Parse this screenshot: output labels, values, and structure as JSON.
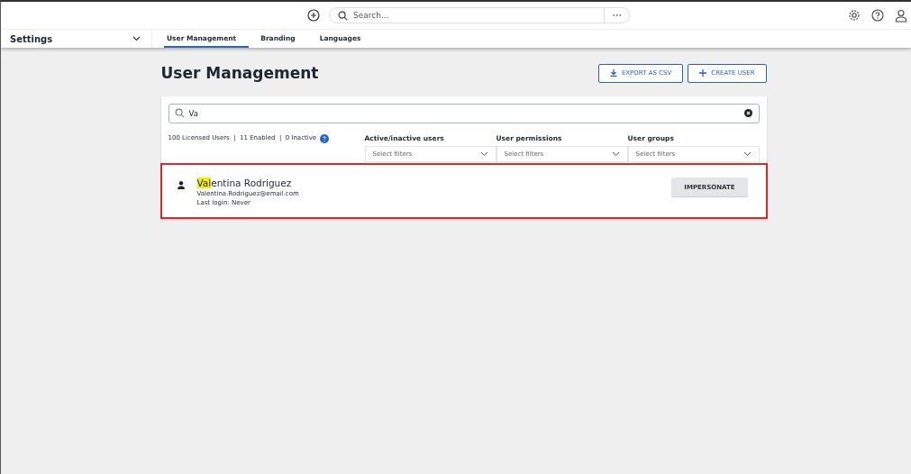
{
  "topbar": {
    "search_placeholder": "Search...",
    "more": "•••"
  },
  "nav": {
    "section": "Settings",
    "tabs": [
      {
        "label": "User Management",
        "selected": true
      },
      {
        "label": "Branding",
        "selected": false
      },
      {
        "label": "Languages",
        "selected": false
      }
    ]
  },
  "page": {
    "title": "User Management",
    "buttons": [
      {
        "kind": "export",
        "label": "EXPORT AS CSV"
      },
      {
        "kind": "create",
        "label": "CREATE USER"
      }
    ]
  },
  "search": {
    "value": "Va"
  },
  "summary": "100 Licensed Users  |  11 Enabled  |  0 Inactive",
  "filters": [
    {
      "label": "Active/inactive users",
      "placeholder": "Select filters"
    },
    {
      "label": "User permissions",
      "placeholder": "Select filters"
    },
    {
      "label": "User groups",
      "placeholder": "Select filters"
    }
  ],
  "results": [
    {
      "name_match": "Val",
      "name_rest": "entina Rodriguez",
      "email": "Valentina.Rodriguez@email.com",
      "last_login": "Last login: Never",
      "action": "IMPERSONATE",
      "highlighted": true
    }
  ]
}
